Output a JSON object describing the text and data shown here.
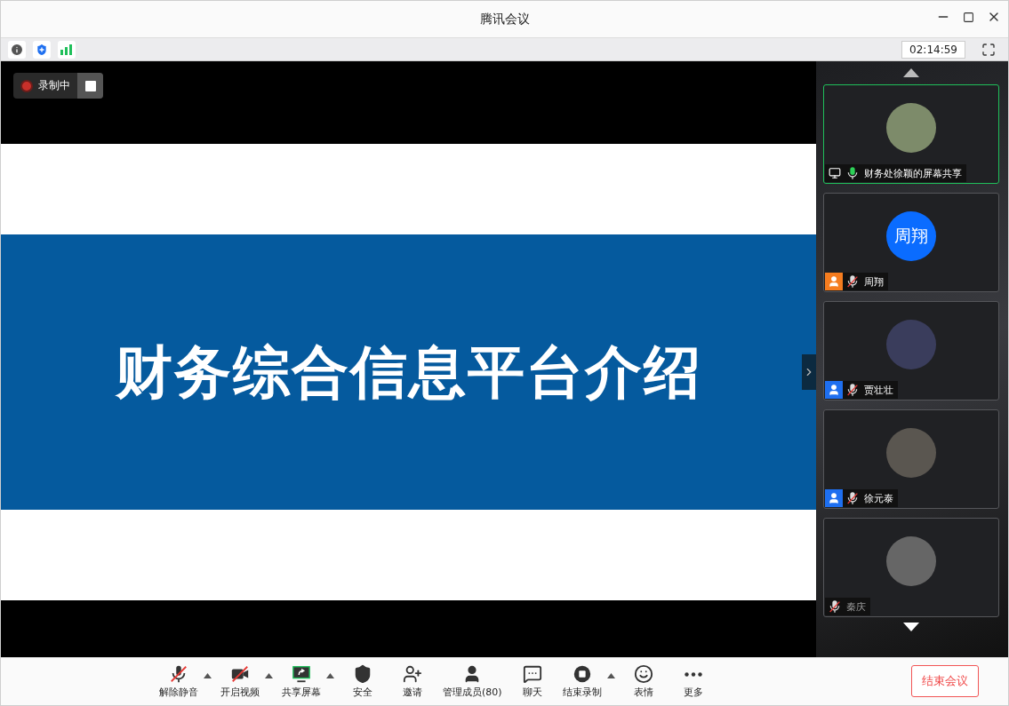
{
  "window": {
    "title": "腾讯会议"
  },
  "info_bar": {
    "timer": "02:14:59"
  },
  "recording": {
    "label": "录制中"
  },
  "slide": {
    "title": "财务综合信息平台介绍"
  },
  "participants": [
    {
      "name": "财务处徐颖的屏幕共享",
      "kind": "photo",
      "sharing": true,
      "muted": false,
      "active": true
    },
    {
      "name": "周翔",
      "kind": "initials",
      "initials": "周翔",
      "color": "#f57c1f",
      "sharing": false,
      "muted": true,
      "active": false
    },
    {
      "name": "贾壮壮",
      "kind": "photo",
      "color": "#1e6ff0",
      "sharing": false,
      "muted": true,
      "active": false
    },
    {
      "name": "徐元泰",
      "kind": "photo",
      "color": "#1e6ff0",
      "sharing": false,
      "muted": true,
      "active": false
    },
    {
      "name": "秦庆",
      "kind": "photo",
      "sharing": false,
      "muted": true,
      "active": false
    }
  ],
  "toolbar": [
    {
      "kind": "mic",
      "label": "解除静音",
      "menu": true,
      "off": true
    },
    {
      "kind": "video",
      "label": "开启视频",
      "menu": true,
      "off": true
    },
    {
      "kind": "share",
      "label": "共享屏幕",
      "menu": true
    },
    {
      "kind": "security",
      "label": "安全",
      "menu": false
    },
    {
      "kind": "invite",
      "label": "邀请",
      "menu": false
    },
    {
      "kind": "members",
      "label": "管理成员(80)",
      "menu": false
    },
    {
      "kind": "chat",
      "label": "聊天",
      "menu": false
    },
    {
      "kind": "record",
      "label": "结束录制",
      "menu": true
    },
    {
      "kind": "emoji",
      "label": "表情",
      "menu": false
    },
    {
      "kind": "more",
      "label": "更多",
      "menu": false
    }
  ],
  "end_button": "结束会议"
}
